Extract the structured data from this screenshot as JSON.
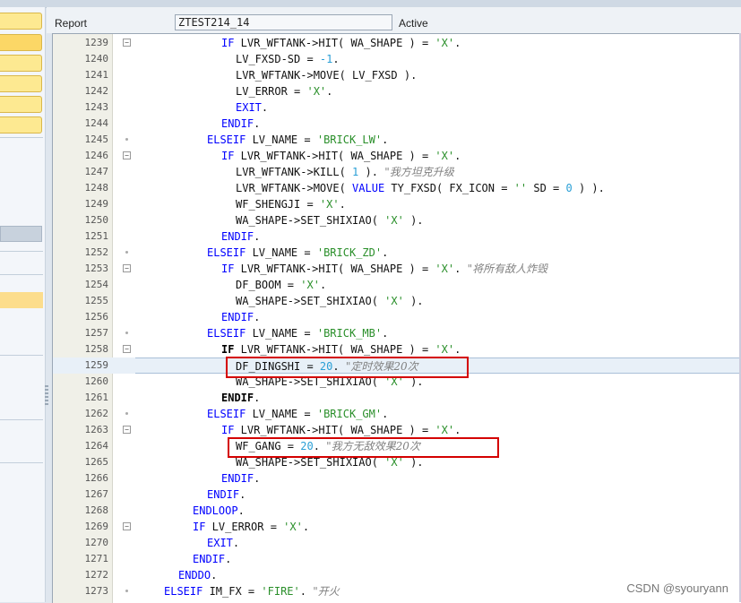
{
  "header": {
    "report_label": "Report",
    "program_name": "ZTEST214_14",
    "status": "Active"
  },
  "watermark": "CSDN @syouryann",
  "colors": {
    "keyword": "#0000ff",
    "string": "#2a8f2a",
    "number": "#2a9fd6",
    "comment": "#808080",
    "highlight_box": "#d40000",
    "nav_button": "#fde991"
  },
  "editor": {
    "current_line": 1259,
    "highlighted_lines": [
      1259,
      1264
    ],
    "lines": [
      {
        "n": "1239",
        "indent": 12,
        "fold": "minus",
        "tokens": [
          [
            "kw",
            "IF"
          ],
          [
            "t",
            " LVR_WFTANK->HIT( WA_SHAPE ) = "
          ],
          [
            "str",
            "'X'"
          ],
          [
            "t",
            "."
          ]
        ]
      },
      {
        "n": "1240",
        "indent": 14,
        "fold": "",
        "tokens": [
          [
            "t",
            "LV_FXSD-SD = "
          ],
          [
            "num",
            "-1"
          ],
          [
            "t",
            "."
          ]
        ]
      },
      {
        "n": "1241",
        "indent": 14,
        "fold": "",
        "tokens": [
          [
            "t",
            "LVR_WFTANK->MOVE( LV_FXSD )."
          ]
        ]
      },
      {
        "n": "1242",
        "indent": 14,
        "fold": "",
        "tokens": [
          [
            "t",
            "LV_ERROR = "
          ],
          [
            "str",
            "'X'"
          ],
          [
            "t",
            "."
          ]
        ]
      },
      {
        "n": "1243",
        "indent": 14,
        "fold": "",
        "tokens": [
          [
            "kw",
            "EXIT"
          ],
          [
            "t",
            "."
          ]
        ]
      },
      {
        "n": "1244",
        "indent": 12,
        "fold": "",
        "tokens": [
          [
            "kw",
            "ENDIF"
          ],
          [
            "t",
            "."
          ]
        ]
      },
      {
        "n": "1245",
        "indent": 10,
        "fold": "dot",
        "tokens": [
          [
            "kw",
            "ELSEIF"
          ],
          [
            "t",
            " LV_NAME = "
          ],
          [
            "str",
            "'BRICK_LW'"
          ],
          [
            "t",
            "."
          ]
        ]
      },
      {
        "n": "1246",
        "indent": 12,
        "fold": "minus",
        "tokens": [
          [
            "kw",
            "IF"
          ],
          [
            "t",
            " LVR_WFTANK->HIT( WA_SHAPE ) = "
          ],
          [
            "str",
            "'X'"
          ],
          [
            "t",
            "."
          ]
        ]
      },
      {
        "n": "1247",
        "indent": 14,
        "fold": "",
        "tokens": [
          [
            "t",
            "LVR_WFTANK->KILL( "
          ],
          [
            "num",
            "1"
          ],
          [
            "t",
            " ). "
          ],
          [
            "cmt",
            "\"我方坦克升级"
          ]
        ]
      },
      {
        "n": "1248",
        "indent": 14,
        "fold": "",
        "tokens": [
          [
            "t",
            "LVR_WFTANK->MOVE( "
          ],
          [
            "kw",
            "VALUE"
          ],
          [
            "t",
            " TY_FXSD( FX_ICON = "
          ],
          [
            "str",
            "''"
          ],
          [
            "t",
            " SD = "
          ],
          [
            "num",
            "0"
          ],
          [
            "t",
            " ) )."
          ]
        ]
      },
      {
        "n": "1249",
        "indent": 14,
        "fold": "",
        "tokens": [
          [
            "t",
            "WF_SHENGJI = "
          ],
          [
            "str",
            "'X'"
          ],
          [
            "t",
            "."
          ]
        ]
      },
      {
        "n": "1250",
        "indent": 14,
        "fold": "",
        "tokens": [
          [
            "t",
            "WA_SHAPE->SET_SHIXIAO( "
          ],
          [
            "str",
            "'X'"
          ],
          [
            "t",
            " )."
          ]
        ]
      },
      {
        "n": "1251",
        "indent": 12,
        "fold": "",
        "tokens": [
          [
            "kw",
            "ENDIF"
          ],
          [
            "t",
            "."
          ]
        ]
      },
      {
        "n": "1252",
        "indent": 10,
        "fold": "dot",
        "tokens": [
          [
            "kw",
            "ELSEIF"
          ],
          [
            "t",
            " LV_NAME = "
          ],
          [
            "str",
            "'BRICK_ZD'"
          ],
          [
            "t",
            "."
          ]
        ]
      },
      {
        "n": "1253",
        "indent": 12,
        "fold": "minus",
        "tokens": [
          [
            "kw",
            "IF"
          ],
          [
            "t",
            " LVR_WFTANK->HIT( WA_SHAPE ) = "
          ],
          [
            "str",
            "'X'"
          ],
          [
            "t",
            ". "
          ],
          [
            "cmt",
            "\"将所有敌人炸毁"
          ]
        ]
      },
      {
        "n": "1254",
        "indent": 14,
        "fold": "",
        "tokens": [
          [
            "t",
            "DF_BOOM = "
          ],
          [
            "str",
            "'X'"
          ],
          [
            "t",
            "."
          ]
        ]
      },
      {
        "n": "1255",
        "indent": 14,
        "fold": "",
        "tokens": [
          [
            "t",
            "WA_SHAPE->SET_SHIXIAO( "
          ],
          [
            "str",
            "'X'"
          ],
          [
            "t",
            " )."
          ]
        ]
      },
      {
        "n": "1256",
        "indent": 12,
        "fold": "",
        "tokens": [
          [
            "kw",
            "ENDIF"
          ],
          [
            "t",
            "."
          ]
        ]
      },
      {
        "n": "1257",
        "indent": 10,
        "fold": "dot",
        "tokens": [
          [
            "kw",
            "ELSEIF"
          ],
          [
            "t",
            " LV_NAME = "
          ],
          [
            "str",
            "'BRICK_MB'"
          ],
          [
            "t",
            "."
          ]
        ]
      },
      {
        "n": "1258",
        "indent": 12,
        "fold": "minus",
        "tokens": [
          [
            "kwb",
            "IF"
          ],
          [
            "t",
            " LVR_WFTANK->HIT( WA_SHAPE ) = "
          ],
          [
            "str",
            "'X'"
          ],
          [
            "t",
            "."
          ]
        ]
      },
      {
        "n": "1259",
        "indent": 14,
        "fold": "",
        "tokens": [
          [
            "t",
            "DF_DINGSHI = "
          ],
          [
            "num",
            "20"
          ],
          [
            "t",
            ". "
          ],
          [
            "cmt",
            "\"定时效果20次"
          ]
        ]
      },
      {
        "n": "1260",
        "indent": 14,
        "fold": "",
        "tokens": [
          [
            "t",
            "WA_SHAPE->SET_SHIXIAO( "
          ],
          [
            "str",
            "'X'"
          ],
          [
            "t",
            " )."
          ]
        ]
      },
      {
        "n": "1261",
        "indent": 12,
        "fold": "",
        "tokens": [
          [
            "kwb",
            "ENDIF"
          ],
          [
            "t",
            "."
          ]
        ]
      },
      {
        "n": "1262",
        "indent": 10,
        "fold": "dot",
        "tokens": [
          [
            "kw",
            "ELSEIF"
          ],
          [
            "t",
            " LV_NAME = "
          ],
          [
            "str",
            "'BRICK_GM'"
          ],
          [
            "t",
            "."
          ]
        ]
      },
      {
        "n": "1263",
        "indent": 12,
        "fold": "minus",
        "tokens": [
          [
            "kw",
            "IF"
          ],
          [
            "t",
            " LVR_WFTANK->HIT( WA_SHAPE ) = "
          ],
          [
            "str",
            "'X'"
          ],
          [
            "t",
            "."
          ]
        ]
      },
      {
        "n": "1264",
        "indent": 14,
        "fold": "",
        "tokens": [
          [
            "t",
            "WF_GANG = "
          ],
          [
            "num",
            "20"
          ],
          [
            "t",
            ". "
          ],
          [
            "cmt",
            "\"我方无敌效果20次"
          ]
        ]
      },
      {
        "n": "1265",
        "indent": 14,
        "fold": "",
        "tokens": [
          [
            "t",
            "WA_SHAPE->SET_SHIXIAO( "
          ],
          [
            "str",
            "'X'"
          ],
          [
            "t",
            " )."
          ]
        ]
      },
      {
        "n": "1266",
        "indent": 12,
        "fold": "",
        "tokens": [
          [
            "kw",
            "ENDIF"
          ],
          [
            "t",
            "."
          ]
        ]
      },
      {
        "n": "1267",
        "indent": 10,
        "fold": "",
        "tokens": [
          [
            "kw",
            "ENDIF"
          ],
          [
            "t",
            "."
          ]
        ]
      },
      {
        "n": "1268",
        "indent": 8,
        "fold": "",
        "tokens": [
          [
            "kw",
            "ENDLOOP"
          ],
          [
            "t",
            "."
          ]
        ]
      },
      {
        "n": "1269",
        "indent": 8,
        "fold": "minus",
        "tokens": [
          [
            "kw",
            "IF"
          ],
          [
            "t",
            " LV_ERROR = "
          ],
          [
            "str",
            "'X'"
          ],
          [
            "t",
            "."
          ]
        ]
      },
      {
        "n": "1270",
        "indent": 10,
        "fold": "",
        "tokens": [
          [
            "kw",
            "EXIT"
          ],
          [
            "t",
            "."
          ]
        ]
      },
      {
        "n": "1271",
        "indent": 8,
        "fold": "",
        "tokens": [
          [
            "kw",
            "ENDIF"
          ],
          [
            "t",
            "."
          ]
        ]
      },
      {
        "n": "1272",
        "indent": 6,
        "fold": "",
        "tokens": [
          [
            "kw",
            "ENDDO"
          ],
          [
            "t",
            "."
          ]
        ]
      },
      {
        "n": "1273",
        "indent": 4,
        "fold": "dot",
        "tokens": [
          [
            "kw",
            "ELSEIF"
          ],
          [
            "t",
            " IM_FX = "
          ],
          [
            "str",
            "'FIRE'"
          ],
          [
            "t",
            ". "
          ],
          [
            "cmt",
            "\"开火"
          ]
        ]
      }
    ]
  }
}
